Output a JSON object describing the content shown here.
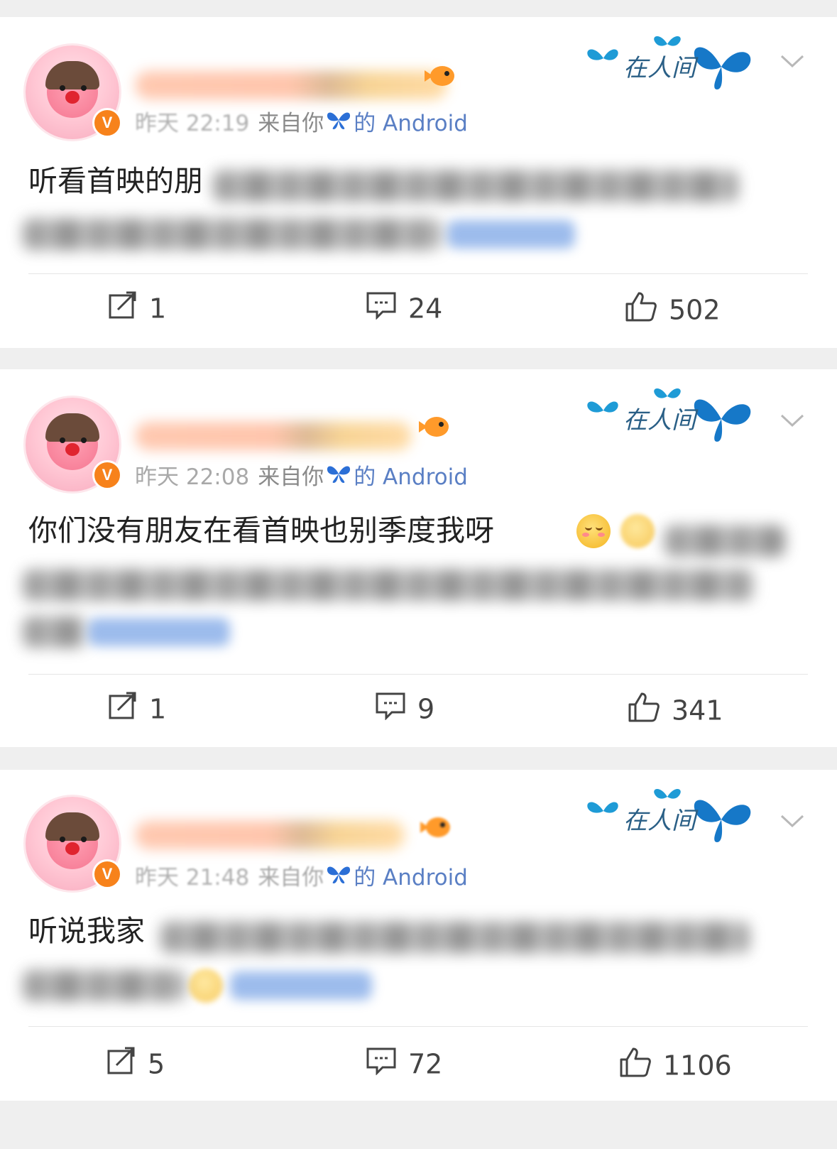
{
  "posts": [
    {
      "time": "昨天 22:19",
      "source_prefix": "来自你",
      "source_suffix": "的 Android",
      "text": "听看首映的朋",
      "deco_text": "在人间",
      "actions": {
        "repost": "1",
        "comment": "24",
        "like": "502"
      }
    },
    {
      "time": "昨天 22:08",
      "source_prefix": "来自你",
      "source_suffix": "的 Android",
      "text": "你们没有朋友在看首映也别季度我呀",
      "deco_text": "在人间",
      "actions": {
        "repost": "1",
        "comment": "9",
        "like": "341"
      }
    },
    {
      "time": "昨天 21:48",
      "source_prefix": "来自你",
      "source_suffix": "的 Android",
      "text": "听说我家",
      "deco_text": "在人间",
      "actions": {
        "repost": "5",
        "comment": "72",
        "like": "1106"
      }
    }
  ],
  "icons": {
    "verified": "V",
    "butterfly": "butterfly-icon",
    "repost": "repost-icon",
    "comment": "comment-icon",
    "like": "like-icon",
    "chevron": "chevron-down-icon"
  },
  "colors": {
    "verified_badge": "#f7821b",
    "source_link": "#5a7fc4",
    "butterfly": "#1e9bd6"
  }
}
